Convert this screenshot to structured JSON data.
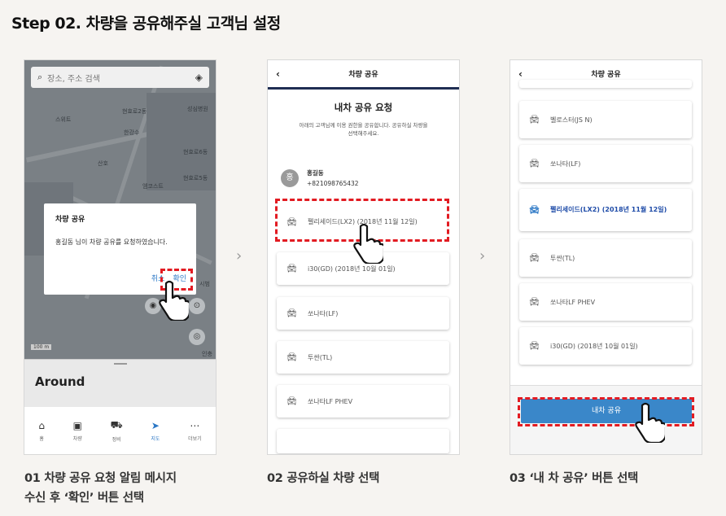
{
  "heading": "Step 02. 차량을 공유해주실 고객님 설정",
  "captions": {
    "c1_line1": "01 차량 공유 요청 알림 메시지",
    "c1_line2": "수신 후 ‘확인’ 버튼 선택",
    "c2": "02 공유하실 차량 선택",
    "c3": "03 ‘내 차 공유’ 버튼 선택"
  },
  "phone1": {
    "search_placeholder": "장소, 주소 검색",
    "map_labels": [
      "현효로2동",
      "스위트",
      "한강수",
      "현효로6동",
      "산호",
      "현효로5동",
      "성심병원",
      "엠코스트",
      "시범",
      "인충로"
    ],
    "dialog": {
      "title": "차량 공유",
      "message": "홍길동 님이 차량 공유를 요청하였습니다.",
      "cancel": "취소",
      "confirm": "확인"
    },
    "scale": "100 m",
    "sheet_title": "Around",
    "tabs": [
      {
        "label": "홈",
        "icon": "home-icon"
      },
      {
        "label": "차량",
        "icon": "key-icon"
      },
      {
        "label": "정비",
        "icon": "car-icon"
      },
      {
        "label": "지도",
        "icon": "navigate-icon"
      },
      {
        "label": "더보기",
        "icon": "more-icon"
      }
    ]
  },
  "phone2": {
    "header": "차량 공유",
    "title": "내차 공유 요청",
    "desc_line1": "아래의 고객님께 이용 권한을 공유합니다. 공유하실 차량을",
    "desc_line2": "선택해주세요.",
    "user_initial": "홍",
    "user_name": "홍길동",
    "user_phone": "+821098765432",
    "cars": [
      "펠리세이드(LX2) (2018년 11월 12일)",
      "i30(GD) (2018년 10월 01일)",
      "쏘나타(LF)",
      "투싼(TL)",
      "쏘나타LF PHEV"
    ]
  },
  "phone3": {
    "header": "차량 공유",
    "cars": [
      "벨로스터(JS N)",
      "쏘나타(LF)",
      "펠리세이드(LX2) (2018년 11월 12일)",
      "투싼(TL)",
      "쏘나타LF PHEV",
      "i30(GD) (2018년 10월 01일)"
    ],
    "share_button": "내차 공유"
  },
  "colors": {
    "highlight": "#e21b22",
    "primary_blue": "#3a87c9",
    "selected_text": "#1f4ca8"
  }
}
